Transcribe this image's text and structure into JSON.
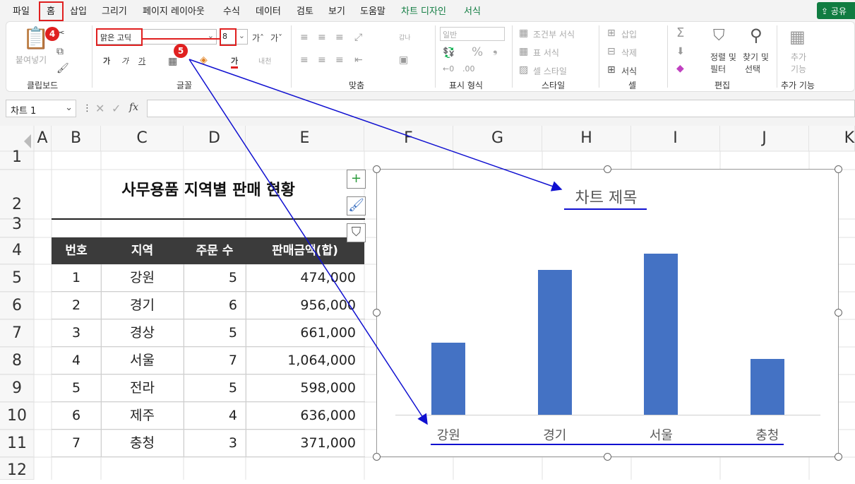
{
  "menu": {
    "items": [
      "파일",
      "홈",
      "삽입",
      "그리기",
      "페이지 레이아웃",
      "수식",
      "데이터",
      "검토",
      "보기",
      "도움말",
      "차트 디자인",
      "서식"
    ],
    "share": "공유"
  },
  "ribbon": {
    "clipboard": {
      "paste": "붙여넣기",
      "label": "클립보드"
    },
    "font": {
      "name": "맑은 고딕",
      "size": "8",
      "label": "글꼴",
      "grow": "가ˆ",
      "shrink": "가ˇ",
      "bold": "가",
      "italic": "가",
      "underline": "가",
      "color_char": "가",
      "phonetic": "내천"
    },
    "align": {
      "label": "맞춤",
      "wrap": "갑나"
    },
    "number": {
      "format": "일반",
      "label": "표시 형식",
      "percent": "%",
      "comma": "❟"
    },
    "styles": {
      "cond": "조건부 서식",
      "table": "표 서식",
      "cell": "셀 스타일",
      "label": "스타일"
    },
    "cells": {
      "insert": "삽입",
      "delete": "삭제",
      "format": "서식",
      "label": "셀"
    },
    "editing": {
      "sort_line1": "정렬 및",
      "sort_line2": "필터",
      "find_line1": "찾기 및",
      "find_line2": "선택",
      "label": "편집"
    },
    "addins": {
      "line1": "추가",
      "line2": "기능",
      "label": "추가 기능"
    }
  },
  "badges": {
    "four": "4",
    "five": "5"
  },
  "formula": {
    "name_box": "차트 1",
    "fx": "fx",
    "value": ""
  },
  "columns": [
    "A",
    "B",
    "C",
    "D",
    "E",
    "F",
    "G",
    "H",
    "I",
    "J",
    "K"
  ],
  "rows": [
    "1",
    "2",
    "3",
    "4",
    "5",
    "6",
    "7",
    "8",
    "9",
    "10",
    "11",
    "12"
  ],
  "sheet": {
    "title": "사무용품 지역별 판매 현황",
    "headers": [
      "번호",
      "지역",
      "주문 수",
      "판매금액(합)"
    ],
    "data": [
      [
        "1",
        "강원",
        "5",
        "474,000"
      ],
      [
        "2",
        "경기",
        "6",
        "956,000"
      ],
      [
        "3",
        "경상",
        "5",
        "661,000"
      ],
      [
        "4",
        "서울",
        "7",
        "1,064,000"
      ],
      [
        "5",
        "전라",
        "5",
        "598,000"
      ],
      [
        "6",
        "제주",
        "4",
        "636,000"
      ],
      [
        "7",
        "충청",
        "3",
        "371,000"
      ]
    ]
  },
  "chart_data": {
    "type": "bar",
    "title": "차트 제목",
    "categories": [
      "강원",
      "경기",
      "서울",
      "충청"
    ],
    "values": [
      474000,
      956000,
      1064000,
      371000
    ],
    "ylim": [
      0,
      1200000
    ],
    "grid": false,
    "colors": {
      "bar": "#4472c4"
    }
  },
  "colors": {
    "accent": "#107c41",
    "highlight": "#e02020",
    "annotation": "#1010d0"
  }
}
